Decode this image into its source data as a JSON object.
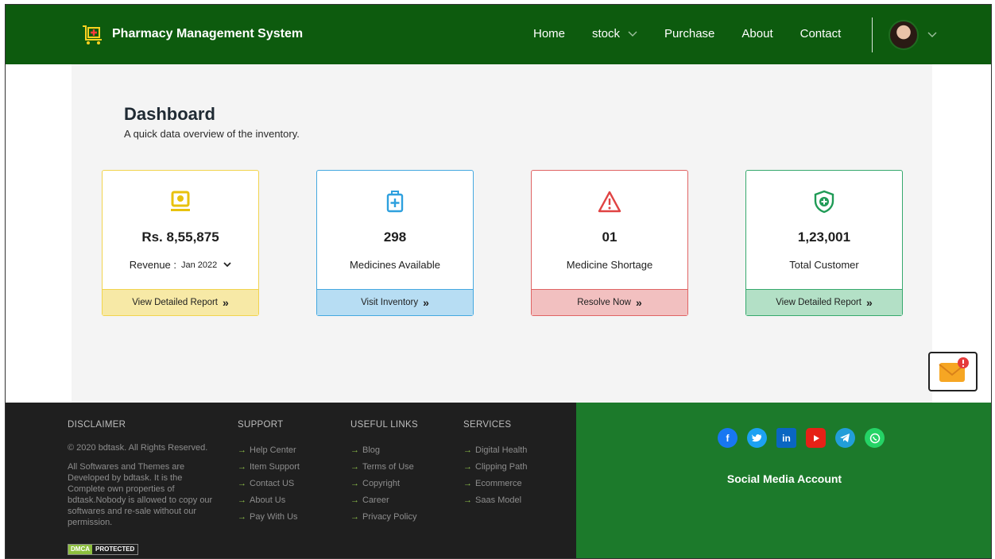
{
  "header": {
    "title": "Pharmacy Management System",
    "nav": [
      "Home",
      "stock",
      "Purchase",
      "About",
      "Contact"
    ]
  },
  "dashboard": {
    "title": "Dashboard",
    "subtitle": "A quick data overview of the inventory.",
    "cards": [
      {
        "value": "Rs. 8,55,875",
        "label": "Revenue :",
        "month": "Jan 2022",
        "action": "View Detailed Report",
        "icon": "money-icon",
        "color": "#f2d44e"
      },
      {
        "value": "298",
        "label": "Medicines Available",
        "action": "Visit Inventory",
        "icon": "medical-kit-icon",
        "color": "#45a8e0"
      },
      {
        "value": "01",
        "label": "Medicine Shortage",
        "action": "Resolve Now",
        "icon": "warning-icon",
        "color": "#e06464"
      },
      {
        "value": "1,23,001",
        "label": "Total Customer",
        "action": "View Detailed Report",
        "icon": "shield-plus-icon",
        "color": "#36a96d"
      }
    ]
  },
  "footer": {
    "disclaimer": {
      "title": "DISCLAIMER",
      "copyright": "© 2020 bdtask. All Rights Reserved.",
      "text": "All Softwares and Themes are Developed by bdtask. It is the Complete own properties of bdtask.Nobody is allowed to copy our softwares and re-sale without our permission.",
      "badge_left": "DMCA",
      "badge_right": "PROTECTED"
    },
    "support": {
      "title": "SUPPORT",
      "links": [
        "Help Center",
        "Item Support",
        "Contact US",
        "About Us",
        "Pay With Us"
      ]
    },
    "useful": {
      "title": "USEFUL LINKS",
      "links": [
        "Blog",
        "Terms of Use",
        "Copyright",
        "Career",
        "Privacy Policy"
      ]
    },
    "services": {
      "title": "SERVICES",
      "links": [
        "Digital Health",
        "Clipping Path",
        "Ecommerce",
        "Saas Model"
      ]
    },
    "social": {
      "caption": "Social Media Account",
      "icons": [
        "facebook-icon",
        "twitter-icon",
        "linkedin-icon",
        "youtube-icon",
        "telegram-icon",
        "whatsapp-icon"
      ]
    }
  },
  "colors": {
    "header_bg": "#0d5b0e",
    "footer_dark": "#1f1f1f",
    "footer_green": "#1c7a2b"
  }
}
